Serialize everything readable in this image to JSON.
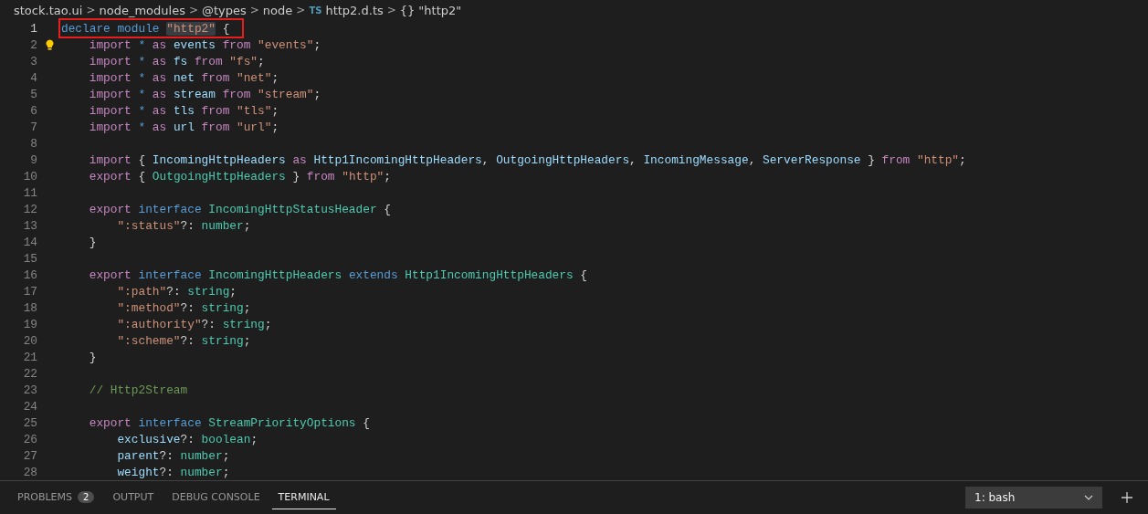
{
  "breadcrumb": [
    {
      "label": "stock.tao.ui"
    },
    {
      "label": "node_modules"
    },
    {
      "label": "@types"
    },
    {
      "label": "node"
    },
    {
      "label": "http2.d.ts",
      "badge": "TS",
      "kind": "file"
    },
    {
      "label": "\"http2\"",
      "badge": "{}",
      "kind": "symbol"
    }
  ],
  "separator": ">",
  "editor": {
    "lines": [
      {
        "number": "1",
        "current": true,
        "annotated": true,
        "lightbulb": false,
        "tokens": [
          {
            "text": "declare module ",
            "kind": "keyword"
          },
          {
            "text": "\"http2\"",
            "kind": "string",
            "highlighted": true
          },
          {
            "text": " {",
            "kind": "punct"
          }
        ]
      },
      {
        "number": "2",
        "current": false,
        "annotated": false,
        "lightbulb": true,
        "tokens": [
          {
            "text": "    import",
            "kind": "control"
          },
          {
            "text": " * ",
            "kind": "keyword"
          },
          {
            "text": "as",
            "kind": "control"
          },
          {
            "text": " events ",
            "kind": "variable"
          },
          {
            "text": "from",
            "kind": "control"
          },
          {
            "text": " \"events\"",
            "kind": "string"
          },
          {
            "text": ";",
            "kind": "punct"
          }
        ]
      },
      {
        "number": "3",
        "current": false,
        "annotated": false,
        "lightbulb": false,
        "tokens": [
          {
            "text": "    import",
            "kind": "control"
          },
          {
            "text": " * ",
            "kind": "keyword"
          },
          {
            "text": "as",
            "kind": "control"
          },
          {
            "text": " fs ",
            "kind": "variable"
          },
          {
            "text": "from",
            "kind": "control"
          },
          {
            "text": " \"fs\"",
            "kind": "string"
          },
          {
            "text": ";",
            "kind": "punct"
          }
        ]
      },
      {
        "number": "4",
        "current": false,
        "annotated": false,
        "lightbulb": false,
        "tokens": [
          {
            "text": "    import",
            "kind": "control"
          },
          {
            "text": " * ",
            "kind": "keyword"
          },
          {
            "text": "as",
            "kind": "control"
          },
          {
            "text": " net ",
            "kind": "variable"
          },
          {
            "text": "from",
            "kind": "control"
          },
          {
            "text": " \"net\"",
            "kind": "string"
          },
          {
            "text": ";",
            "kind": "punct"
          }
        ]
      },
      {
        "number": "5",
        "current": false,
        "annotated": false,
        "lightbulb": false,
        "tokens": [
          {
            "text": "    import",
            "kind": "control"
          },
          {
            "text": " * ",
            "kind": "keyword"
          },
          {
            "text": "as",
            "kind": "control"
          },
          {
            "text": " stream ",
            "kind": "variable"
          },
          {
            "text": "from",
            "kind": "control"
          },
          {
            "text": " \"stream\"",
            "kind": "string"
          },
          {
            "text": ";",
            "kind": "punct"
          }
        ]
      },
      {
        "number": "6",
        "current": false,
        "annotated": false,
        "lightbulb": false,
        "tokens": [
          {
            "text": "    import",
            "kind": "control"
          },
          {
            "text": " * ",
            "kind": "keyword"
          },
          {
            "text": "as",
            "kind": "control"
          },
          {
            "text": " tls ",
            "kind": "variable"
          },
          {
            "text": "from",
            "kind": "control"
          },
          {
            "text": " \"tls\"",
            "kind": "string"
          },
          {
            "text": ";",
            "kind": "punct"
          }
        ]
      },
      {
        "number": "7",
        "current": false,
        "annotated": false,
        "lightbulb": false,
        "tokens": [
          {
            "text": "    import",
            "kind": "control"
          },
          {
            "text": " * ",
            "kind": "keyword"
          },
          {
            "text": "as",
            "kind": "control"
          },
          {
            "text": " url ",
            "kind": "variable"
          },
          {
            "text": "from",
            "kind": "control"
          },
          {
            "text": " \"url\"",
            "kind": "string"
          },
          {
            "text": ";",
            "kind": "punct"
          }
        ]
      },
      {
        "number": "8",
        "current": false,
        "annotated": false,
        "lightbulb": false
      },
      {
        "number": "9",
        "current": false,
        "annotated": false,
        "lightbulb": false,
        "tokens": [
          {
            "text": "    import",
            "kind": "control"
          },
          {
            "text": " { ",
            "kind": "punct"
          },
          {
            "text": "IncomingHttpHeaders ",
            "kind": "variable"
          },
          {
            "text": "as",
            "kind": "control"
          },
          {
            "text": " Http1IncomingHttpHeaders",
            "kind": "variable"
          },
          {
            "text": ", ",
            "kind": "punct"
          },
          {
            "text": "OutgoingHttpHeaders",
            "kind": "variable"
          },
          {
            "text": ", ",
            "kind": "punct"
          },
          {
            "text": "IncomingMessage",
            "kind": "variable"
          },
          {
            "text": ", ",
            "kind": "punct"
          },
          {
            "text": "ServerResponse",
            "kind": "variable"
          },
          {
            "text": " } ",
            "kind": "punct"
          },
          {
            "text": "from",
            "kind": "control"
          },
          {
            "text": " \"http\"",
            "kind": "string"
          },
          {
            "text": ";",
            "kind": "punct"
          }
        ]
      },
      {
        "number": "10",
        "current": false,
        "annotated": false,
        "lightbulb": false,
        "tokens": [
          {
            "text": "    export",
            "kind": "control"
          },
          {
            "text": " { ",
            "kind": "punct"
          },
          {
            "text": "OutgoingHttpHeaders",
            "kind": "type"
          },
          {
            "text": " } ",
            "kind": "punct"
          },
          {
            "text": "from",
            "kind": "control"
          },
          {
            "text": " \"http\"",
            "kind": "string"
          },
          {
            "text": ";",
            "kind": "punct"
          }
        ]
      },
      {
        "number": "11",
        "current": false,
        "annotated": false,
        "lightbulb": false
      },
      {
        "number": "12",
        "current": false,
        "annotated": false,
        "lightbulb": false,
        "tokens": [
          {
            "text": "    export",
            "kind": "control"
          },
          {
            "text": " interface ",
            "kind": "keyword"
          },
          {
            "text": "IncomingHttpStatusHeader",
            "kind": "type"
          },
          {
            "text": " {",
            "kind": "punct"
          }
        ]
      },
      {
        "number": "13",
        "current": false,
        "annotated": false,
        "lightbulb": false,
        "tokens": [
          {
            "text": "        \":status\"",
            "kind": "string"
          },
          {
            "text": "?: ",
            "kind": "punct"
          },
          {
            "text": "number",
            "kind": "type"
          },
          {
            "text": ";",
            "kind": "punct"
          }
        ]
      },
      {
        "number": "14",
        "current": false,
        "annotated": false,
        "lightbulb": false,
        "tokens": [
          {
            "text": "    }",
            "kind": "punct"
          }
        ]
      },
      {
        "number": "15",
        "current": false,
        "annotated": false,
        "lightbulb": false
      },
      {
        "number": "16",
        "current": false,
        "annotated": false,
        "lightbulb": false,
        "tokens": [
          {
            "text": "    export",
            "kind": "control"
          },
          {
            "text": " interface ",
            "kind": "keyword"
          },
          {
            "text": "IncomingHttpHeaders",
            "kind": "type"
          },
          {
            "text": " extends ",
            "kind": "keyword"
          },
          {
            "text": "Http1IncomingHttpHeaders",
            "kind": "type"
          },
          {
            "text": " {",
            "kind": "punct"
          }
        ]
      },
      {
        "number": "17",
        "current": false,
        "annotated": false,
        "lightbulb": false,
        "tokens": [
          {
            "text": "        \":path\"",
            "kind": "string"
          },
          {
            "text": "?: ",
            "kind": "punct"
          },
          {
            "text": "string",
            "kind": "type"
          },
          {
            "text": ";",
            "kind": "punct"
          }
        ]
      },
      {
        "number": "18",
        "current": false,
        "annotated": false,
        "lightbulb": false,
        "tokens": [
          {
            "text": "        \":method\"",
            "kind": "string"
          },
          {
            "text": "?: ",
            "kind": "punct"
          },
          {
            "text": "string",
            "kind": "type"
          },
          {
            "text": ";",
            "kind": "punct"
          }
        ]
      },
      {
        "number": "19",
        "current": false,
        "annotated": false,
        "lightbulb": false,
        "tokens": [
          {
            "text": "        \":authority\"",
            "kind": "string"
          },
          {
            "text": "?: ",
            "kind": "punct"
          },
          {
            "text": "string",
            "kind": "type"
          },
          {
            "text": ";",
            "kind": "punct"
          }
        ]
      },
      {
        "number": "20",
        "current": false,
        "annotated": false,
        "lightbulb": false,
        "tokens": [
          {
            "text": "        \":scheme\"",
            "kind": "string"
          },
          {
            "text": "?: ",
            "kind": "punct"
          },
          {
            "text": "string",
            "kind": "type"
          },
          {
            "text": ";",
            "kind": "punct"
          }
        ]
      },
      {
        "number": "21",
        "current": false,
        "annotated": false,
        "lightbulb": false,
        "tokens": [
          {
            "text": "    }",
            "kind": "punct"
          }
        ]
      },
      {
        "number": "22",
        "current": false,
        "annotated": false,
        "lightbulb": false
      },
      {
        "number": "23",
        "current": false,
        "annotated": false,
        "lightbulb": false,
        "tokens": [
          {
            "text": "    // Http2Stream",
            "kind": "comment"
          }
        ]
      },
      {
        "number": "24",
        "current": false,
        "annotated": false,
        "lightbulb": false
      },
      {
        "number": "25",
        "current": false,
        "annotated": false,
        "lightbulb": false,
        "tokens": [
          {
            "text": "    export",
            "kind": "control"
          },
          {
            "text": " interface ",
            "kind": "keyword"
          },
          {
            "text": "StreamPriorityOptions",
            "kind": "type"
          },
          {
            "text": " {",
            "kind": "punct"
          }
        ]
      },
      {
        "number": "26",
        "current": false,
        "annotated": false,
        "lightbulb": false,
        "tokens": [
          {
            "text": "        exclusive",
            "kind": "variable"
          },
          {
            "text": "?: ",
            "kind": "punct"
          },
          {
            "text": "boolean",
            "kind": "type"
          },
          {
            "text": ";",
            "kind": "punct"
          }
        ]
      },
      {
        "number": "27",
        "current": false,
        "annotated": false,
        "lightbulb": false,
        "tokens": [
          {
            "text": "        parent",
            "kind": "variable"
          },
          {
            "text": "?: ",
            "kind": "punct"
          },
          {
            "text": "number",
            "kind": "type"
          },
          {
            "text": ";",
            "kind": "punct"
          }
        ]
      },
      {
        "number": "28",
        "current": false,
        "annotated": false,
        "lightbulb": false,
        "tokens": [
          {
            "text": "        weight",
            "kind": "variable"
          },
          {
            "text": "?: ",
            "kind": "punct"
          },
          {
            "text": "number",
            "kind": "type"
          },
          {
            "text": ";",
            "kind": "punct"
          }
        ]
      }
    ]
  },
  "panel": {
    "tabs": [
      {
        "label": "PROBLEMS",
        "count": "2",
        "selected": false
      },
      {
        "label": "OUTPUT",
        "selected": false
      },
      {
        "label": "DEBUG CONSOLE",
        "selected": false
      },
      {
        "label": "TERMINAL",
        "selected": true
      }
    ],
    "terminal_select": "1: bash"
  }
}
